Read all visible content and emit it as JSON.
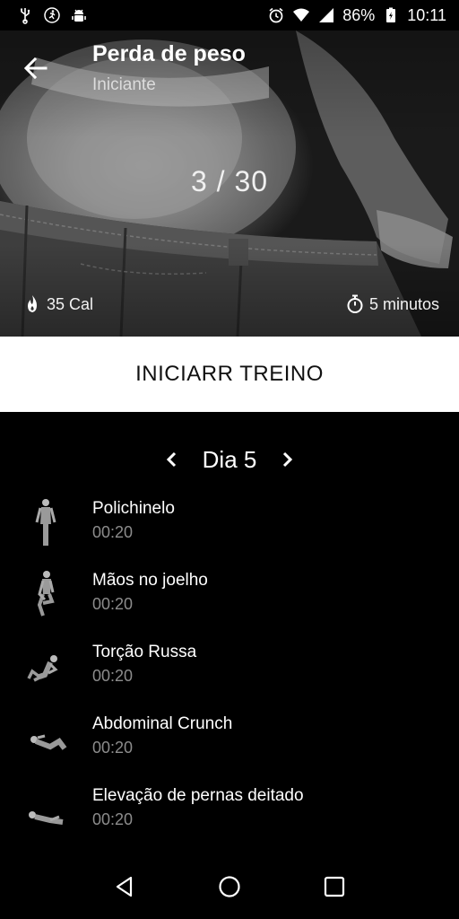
{
  "status_bar": {
    "battery": "86%",
    "time": "10:11",
    "icons": [
      "usb-icon",
      "running-icon",
      "android-debug-icon",
      "alarm-icon",
      "wifi-icon",
      "signal-icon",
      "battery-icon"
    ]
  },
  "header": {
    "title": "Perda de peso",
    "subtitle": "Iniciante",
    "progress": "3 / 30",
    "calories": "35 Cal",
    "duration": "5 minutos"
  },
  "start_button": {
    "label": "INICIARR TREINO"
  },
  "day_nav": {
    "label": "Dia 5"
  },
  "exercises": [
    {
      "name": "Polichinelo",
      "time": "00:20"
    },
    {
      "name": "Mãos no joelho",
      "time": "00:20"
    },
    {
      "name": "Torção Russa",
      "time": "00:20"
    },
    {
      "name": "Abdominal Crunch",
      "time": "00:20"
    },
    {
      "name": "Elevação de pernas deitado",
      "time": "00:20"
    }
  ],
  "colors": {
    "background": "#000000",
    "button_bg": "#ffffff",
    "muted_text": "#8c8c8c"
  }
}
